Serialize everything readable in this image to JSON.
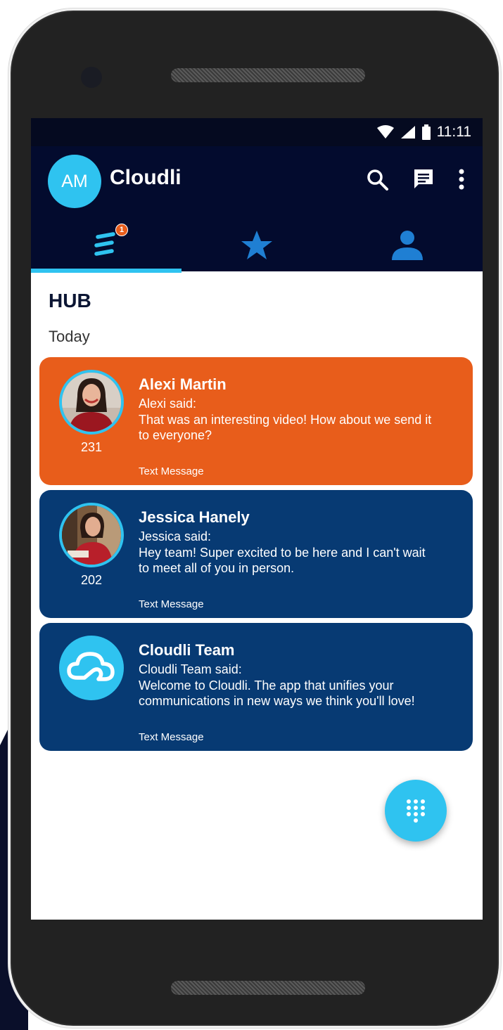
{
  "status_bar": {
    "time": "11:11"
  },
  "app_bar": {
    "avatar_initials": "AM",
    "title": "Cloudli"
  },
  "tabs": [
    {
      "icon": "hub-lines-icon",
      "badge": "1",
      "selected": true
    },
    {
      "icon": "star-icon",
      "selected": false
    },
    {
      "icon": "person-icon",
      "selected": false
    }
  ],
  "hub": {
    "title": "HUB",
    "section_label": "Today",
    "items": [
      {
        "name": "Alexi Martin",
        "said": "Alexi said:",
        "message": "That was an interesting video! How about we send it to everyone?",
        "count": "231",
        "type": "Text Message",
        "color": "#e85d1b",
        "avatar": "alexi-photo"
      },
      {
        "name": "Jessica Hanely",
        "said": "Jessica said:",
        "message": "Hey team! Super excited to be here and I can't wait to meet all of you in person.",
        "count": "202",
        "type": "Text Message",
        "color": "#073a73",
        "avatar": "jessica-photo"
      },
      {
        "name": "Cloudli Team",
        "said": "Cloudli Team said:",
        "message": "Welcome to Cloudli. The app that unifies your communications in new ways we think you'll love!",
        "count": "",
        "type": "Text Message",
        "color": "#073a73",
        "avatar": "cloud-logo-icon"
      }
    ]
  },
  "colors": {
    "accent": "#2fc3f0",
    "app_bar": "#030b2e",
    "badge": "#e85d1b"
  }
}
